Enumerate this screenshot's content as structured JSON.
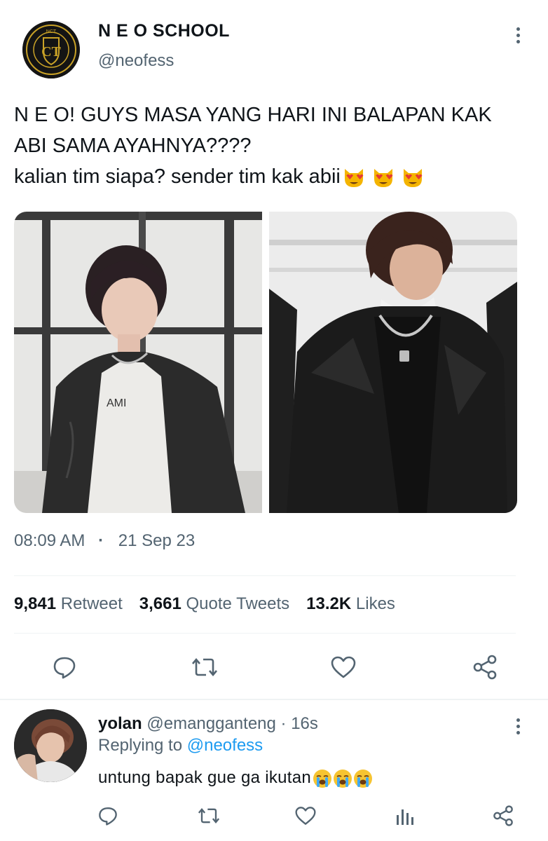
{
  "tweet": {
    "display_name": "N E O SCHOOL",
    "handle": "@neofess",
    "avatar_text": "NCT",
    "avatar_ring_text": "NEO CULTURE TECHNOLOGY",
    "text_lines": [
      "N E O! GUYS MASA YANG HARI INI BALAPAN KAK",
      "ABI SAMA AYAHNYA????",
      "kalian tim siapa? sender tim kak abii"
    ],
    "emoji": "heart-eyes-cat",
    "time": "08:09 AM",
    "separator": "·",
    "date": "21 Sep 23",
    "stats": {
      "retweets": "9,841",
      "retweets_label": "Retweet",
      "quotes": "3,661",
      "quotes_label": "Quote Tweets",
      "likes": "13.2K",
      "likes_label": "Likes"
    },
    "media": {
      "left_shirt_text": "AMI"
    }
  },
  "reply": {
    "name": "yolan",
    "handle": "@emangganteng",
    "separator": "·",
    "time": "16s",
    "replying_prefix": "Replying to",
    "replying_to": "@neofess",
    "text": "untung bapak gue ga ikutan",
    "emoji": "loudly-crying-face"
  },
  "colors": {
    "primary_text": "#0f1419",
    "secondary_text": "#536471",
    "link": "#1d9bf0",
    "divider": "#eff3f4",
    "avatar_gold": "#c9a227"
  }
}
